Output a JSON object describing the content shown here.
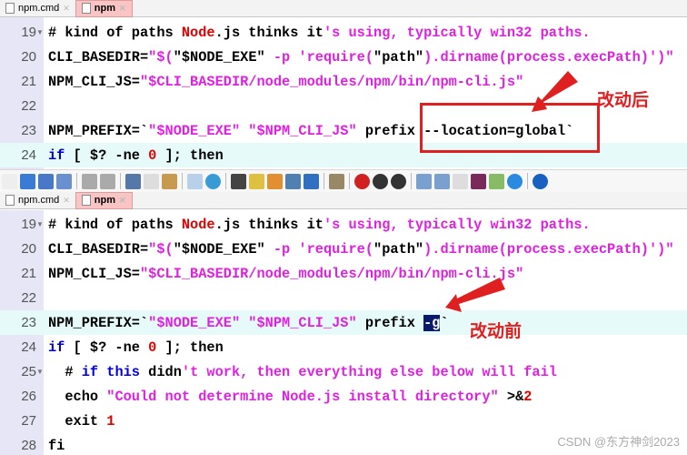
{
  "top_tabs": [
    {
      "label": "npm.cmd",
      "active": false
    },
    {
      "label": "npm",
      "active": true
    }
  ],
  "bottom_tabs": [
    {
      "label": "npm.cmd",
      "active": false
    },
    {
      "label": "npm",
      "active": true
    }
  ],
  "top_lines": [
    {
      "num": "19",
      "fold": true,
      "tokens": [
        [
          "# kind of paths ",
          "default"
        ],
        [
          "Node",
          "number"
        ],
        [
          ".js thinks it",
          "default"
        ],
        [
          "'s using, typically win32 paths.",
          "string"
        ]
      ]
    },
    {
      "num": "20",
      "tokens": [
        [
          "CLI_BASEDIR=",
          "default"
        ],
        [
          "\"$(",
          "string"
        ],
        [
          "\"$NODE_EXE\"",
          "default"
        ],
        [
          " -p 'require(",
          "string"
        ],
        [
          "\"path\"",
          "default"
        ],
        [
          ").dirname(process.execPath)')\"",
          "string"
        ]
      ]
    },
    {
      "num": "21",
      "tokens": [
        [
          "NPM_CLI_JS=",
          "default"
        ],
        [
          "\"$CLI_BASEDIR/node_modules/npm/bin/npm-cli.js\"",
          "string"
        ]
      ]
    },
    {
      "num": "22",
      "tokens": []
    },
    {
      "num": "23",
      "tokens": [
        [
          "NPM_PREFIX=`",
          "default"
        ],
        [
          "\"$NODE_EXE\" \"$NPM_CLI_JS\"",
          "string"
        ],
        [
          " prefix ",
          "default"
        ],
        [
          "--location=global`",
          "default"
        ]
      ]
    },
    {
      "num": "24",
      "highlight": true,
      "tokens": [
        [
          "if",
          "keyword"
        ],
        [
          " [ $? -ne ",
          "default"
        ],
        [
          "0",
          "number"
        ],
        [
          " ]; then",
          "default"
        ]
      ]
    }
  ],
  "bottom_lines": [
    {
      "num": "19",
      "fold": true,
      "tokens": [
        [
          "# kind of paths ",
          "default"
        ],
        [
          "Node",
          "number"
        ],
        [
          ".js thinks it",
          "default"
        ],
        [
          "'s using, typically win32 paths.",
          "string"
        ]
      ]
    },
    {
      "num": "20",
      "tokens": [
        [
          "CLI_BASEDIR=",
          "default"
        ],
        [
          "\"$(",
          "string"
        ],
        [
          "\"$NODE_EXE\"",
          "default"
        ],
        [
          " -p 'require(",
          "string"
        ],
        [
          "\"path\"",
          "default"
        ],
        [
          ").dirname(process.execPath)')\"",
          "string"
        ]
      ]
    },
    {
      "num": "21",
      "tokens": [
        [
          "NPM_CLI_JS=",
          "default"
        ],
        [
          "\"$CLI_BASEDIR/node_modules/npm/bin/npm-cli.js\"",
          "string"
        ]
      ]
    },
    {
      "num": "22",
      "tokens": []
    },
    {
      "num": "23",
      "highlight": true,
      "tokens": [
        [
          "NPM_PREFIX=`",
          "default"
        ],
        [
          "\"$NODE_EXE\" \"$NPM_CLI_JS\"",
          "string"
        ],
        [
          " prefix ",
          "default"
        ],
        [
          "-g",
          "sel"
        ],
        [
          "`",
          "default"
        ]
      ]
    },
    {
      "num": "24",
      "tokens": [
        [
          "if",
          "keyword"
        ],
        [
          " [ $? -ne ",
          "default"
        ],
        [
          "0",
          "number"
        ],
        [
          " ]; then",
          "default"
        ]
      ]
    },
    {
      "num": "25",
      "fold": true,
      "tokens": [
        [
          "  # ",
          "default"
        ],
        [
          "if",
          "keyword"
        ],
        [
          " ",
          "default"
        ],
        [
          "this",
          "keyword"
        ],
        [
          " didn",
          "default"
        ],
        [
          "'t work, then everything else below will fail",
          "string"
        ]
      ]
    },
    {
      "num": "26",
      "tokens": [
        [
          "  echo ",
          "default"
        ],
        [
          "\"Could not determine Node.js install directory\"",
          "string"
        ],
        [
          " >&",
          "default"
        ],
        [
          "2",
          "number"
        ]
      ]
    },
    {
      "num": "27",
      "tokens": [
        [
          "  exit ",
          "default"
        ],
        [
          "1",
          "number"
        ]
      ]
    },
    {
      "num": "28",
      "tokens": [
        [
          "fi",
          "default"
        ]
      ]
    }
  ],
  "toolbar": [
    {
      "icon": "new-file-icon",
      "color": "#eeeeee"
    },
    {
      "icon": "open-folder-icon",
      "color": "#3a7bd5"
    },
    {
      "icon": "save-icon",
      "color": "#4a78c8"
    },
    {
      "icon": "save-all-icon",
      "color": "#6a90d0"
    },
    "sep",
    {
      "icon": "undo-icon",
      "color": "#aaaaaa"
    },
    {
      "icon": "redo-icon",
      "color": "#aaaaaa"
    },
    "sep",
    {
      "icon": "cut-icon",
      "color": "#5577aa"
    },
    {
      "icon": "copy-icon",
      "color": "#dddddd"
    },
    {
      "icon": "paste-icon",
      "color": "#c89a50"
    },
    "sep",
    {
      "icon": "outline-icon",
      "color": "#b8d0ea"
    },
    {
      "icon": "globe-icon",
      "color": "#3a9ad5"
    },
    "sep",
    {
      "icon": "find-icon",
      "color": "#444444"
    },
    {
      "icon": "highlight-icon",
      "color": "#e0c040"
    },
    {
      "icon": "replace-icon",
      "color": "#e09030"
    },
    {
      "icon": "find-in-files-icon",
      "color": "#5080b0"
    },
    {
      "icon": "spellcheck-icon",
      "color": "#3070c0"
    },
    "sep",
    {
      "icon": "column-mode-icon",
      "color": "#998866"
    },
    "sep",
    {
      "icon": "record-macro-icon",
      "color": "#d02020"
    },
    {
      "icon": "play-macro-icon",
      "color": "#333333"
    },
    {
      "icon": "run-macro-multiple-icon",
      "color": "#333333"
    },
    "sep",
    {
      "icon": "split-vertical-icon",
      "color": "#7aa0d0"
    },
    {
      "icon": "split-horizontal-icon",
      "color": "#7aa0d0"
    },
    {
      "icon": "window-icon",
      "color": "#dddddd"
    },
    {
      "icon": "terminal-icon",
      "color": "#7a2a5a"
    },
    {
      "icon": "grid-icon",
      "color": "#88bb66"
    },
    {
      "icon": "browser-icon",
      "color": "#2a8ae0"
    },
    "sep",
    {
      "icon": "info-icon",
      "color": "#1a60c0"
    }
  ],
  "annotations": {
    "after": "改动后",
    "before": "改动前",
    "color": "#e02020"
  },
  "watermark": "CSDN @东方神剑2023"
}
